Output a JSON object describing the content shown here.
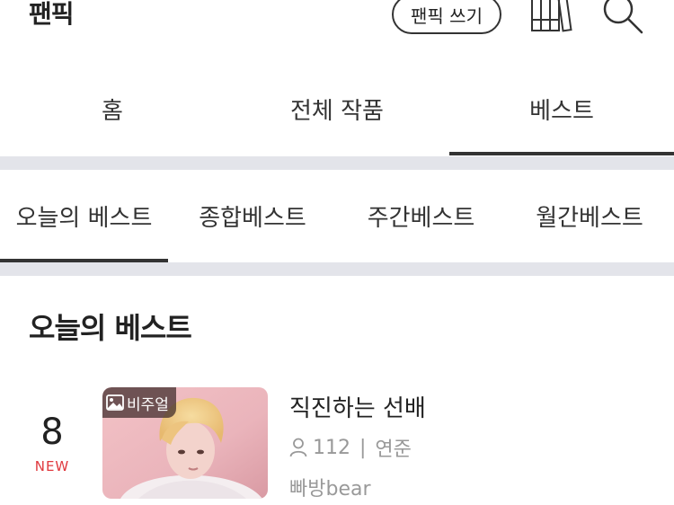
{
  "header": {
    "title": "팬픽",
    "write_button": "팬픽 쓰기"
  },
  "main_tabs": [
    {
      "label": "홈",
      "active": false
    },
    {
      "label": "전체 작품",
      "active": false
    },
    {
      "label": "베스트",
      "active": true
    }
  ],
  "sub_tabs": [
    {
      "label": "오늘의 베스트",
      "active": true
    },
    {
      "label": "종합베스트",
      "active": false
    },
    {
      "label": "주간베스트",
      "active": false
    },
    {
      "label": "월간베스트",
      "active": false
    }
  ],
  "section": {
    "title": "오늘의 베스트"
  },
  "items": [
    {
      "rank": "8",
      "badge": "NEW",
      "thumb_badge": "비주얼",
      "title": "직진하는 선배",
      "views": "112",
      "status": "연준",
      "author": "빠방bear"
    }
  ],
  "colors": {
    "new_badge": "#e0393e",
    "separator": "#e3e4ea",
    "active_underline": "#333333"
  }
}
